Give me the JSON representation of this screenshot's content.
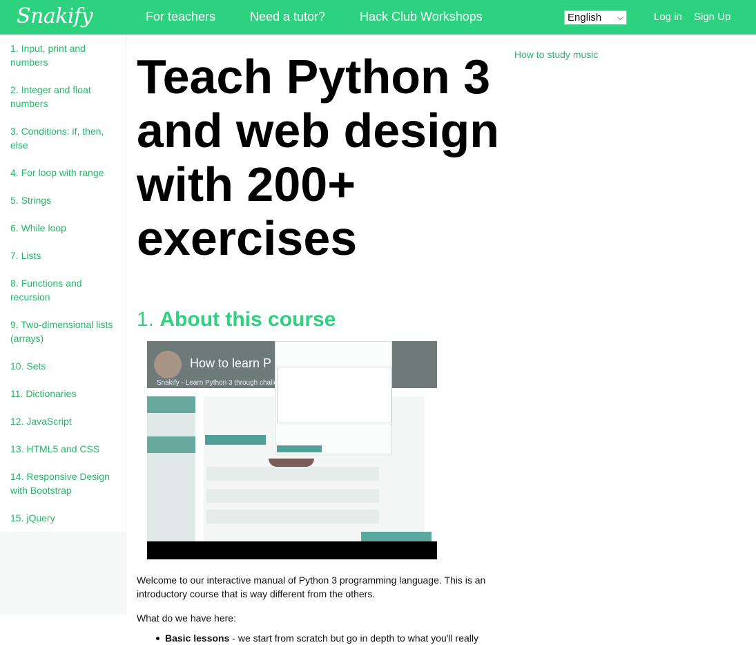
{
  "header": {
    "logo": "Snakify",
    "nav": [
      "For teachers",
      "Need a tutor?",
      "Hack Club Workshops"
    ],
    "language": "English",
    "login": "Log in",
    "signup": "Sign Up"
  },
  "sidebar": {
    "items": [
      "1. Input, print and numbers",
      "2. Integer and float numbers",
      "3. Conditions: if, then, else",
      "4. For loop with range",
      "5. Strings",
      "6. While loop",
      "7. Lists",
      "8. Functions and recursion",
      "9. Two-dimensional lists (arrays)",
      "10. Sets",
      "11. Dictionaries",
      "12. JavaScript",
      "13. HTML5 and CSS",
      "14. Responsive Design with Bootstrap",
      "15. jQuery"
    ]
  },
  "main": {
    "title": "Teach Python 3 and web design with 200+ exercises",
    "section_number": "1.",
    "section_title": "About this course",
    "video_title": "How to learn P",
    "video_subtitle": "Snakify - Learn Python 3 through challenging p",
    "intro": "Welcome to our interactive manual of Python 3 programming language. This is an introductory course that is way different from the others.",
    "what_we_have": "What do we have here:",
    "bullet_bold": "Basic lessons",
    "bullet_text": " - we start from scratch but go in depth to what you'll really"
  },
  "right": {
    "link": "How to study music"
  },
  "colors": {
    "brand": "#2cd27e",
    "link": "#29b56b"
  }
}
